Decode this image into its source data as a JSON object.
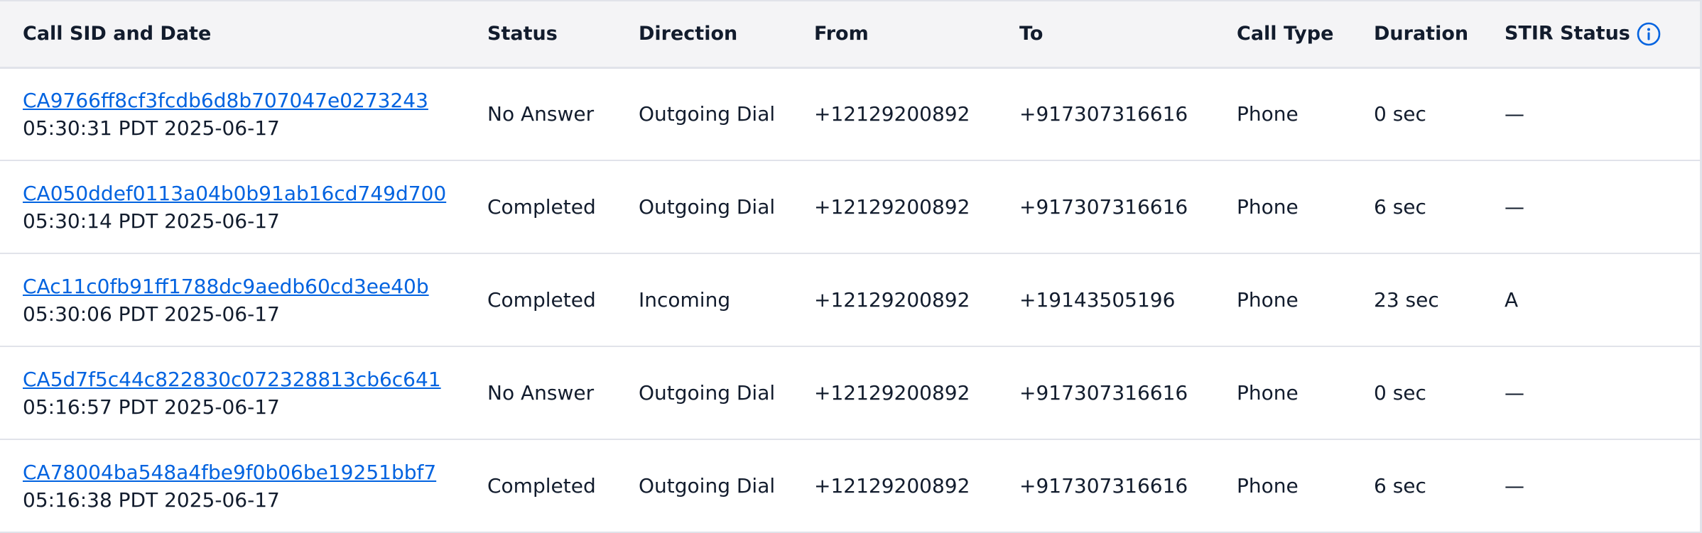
{
  "columns": {
    "sid": "Call SID and Date",
    "status": "Status",
    "direction": "Direction",
    "from": "From",
    "to": "To",
    "call_type": "Call Type",
    "duration": "Duration",
    "stir": "STIR Status"
  },
  "link_color": "#0263e0",
  "rows": [
    {
      "sid": "CA9766ff8cf3fcdb6d8b707047e0273243",
      "date": "05:30:31 PDT 2025-06-17",
      "status": "No Answer",
      "direction": "Outgoing Dial",
      "from": "+12129200892",
      "to": "+917307316616",
      "call_type": "Phone",
      "duration": "0 sec",
      "stir": "—"
    },
    {
      "sid": "CA050ddef0113a04b0b91ab16cd749d700",
      "date": "05:30:14 PDT 2025-06-17",
      "status": "Completed",
      "direction": "Outgoing Dial",
      "from": "+12129200892",
      "to": "+917307316616",
      "call_type": "Phone",
      "duration": "6 sec",
      "stir": "—"
    },
    {
      "sid": "CAc11c0fb91ff1788dc9aedb60cd3ee40b",
      "date": "05:30:06 PDT 2025-06-17",
      "status": "Completed",
      "direction": "Incoming",
      "from": "+12129200892",
      "to": "+19143505196",
      "call_type": "Phone",
      "duration": "23 sec",
      "stir": "A"
    },
    {
      "sid": "CA5d7f5c44c822830c072328813cb6c641",
      "date": "05:16:57 PDT 2025-06-17",
      "status": "No Answer",
      "direction": "Outgoing Dial",
      "from": "+12129200892",
      "to": "+917307316616",
      "call_type": "Phone",
      "duration": "0 sec",
      "stir": "—"
    },
    {
      "sid": "CA78004ba548a4fbe9f0b06be19251bbf7",
      "date": "05:16:38 PDT 2025-06-17",
      "status": "Completed",
      "direction": "Outgoing Dial",
      "from": "+12129200892",
      "to": "+917307316616",
      "call_type": "Phone",
      "duration": "6 sec",
      "stir": "—"
    }
  ]
}
